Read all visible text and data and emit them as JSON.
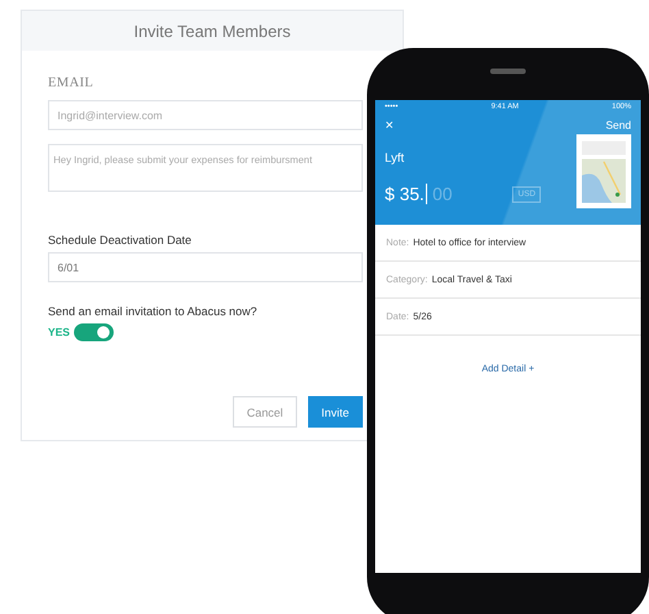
{
  "form": {
    "title": "Invite Team Members",
    "email_label": "EMAIL",
    "email": {
      "placeholder": "Ingrid@interview.com"
    },
    "message": {
      "placeholder": "Hey Ingrid, please submit your expenses for reimbursment"
    },
    "date_label": "Schedule Deactivation Date",
    "date": {
      "value": "6/01"
    },
    "invite_question": "Send an email invitation to Abacus now?",
    "invite_toggle": {
      "label": "YES",
      "on": true
    },
    "buttons": [
      {
        "label": "Cancel",
        "kind": "secondary"
      },
      {
        "label": "Invite",
        "kind": "primary"
      }
    ]
  },
  "phone": {
    "status": {
      "carrier": "•••••",
      "time": "9:41 AM",
      "battery": "100%"
    },
    "close": "✕",
    "send": "Send",
    "merchant": "Lyft",
    "amount": "$ 35.",
    "amount_hint": "00",
    "currency": "USD",
    "fields": [
      {
        "label": "Note:",
        "value": "Hotel to office for interview"
      },
      {
        "label": "Category:",
        "value": "Local Travel & Taxi"
      },
      {
        "label": "Date:",
        "value": "5/26"
      }
    ],
    "add_detail": "Add Detail +"
  }
}
